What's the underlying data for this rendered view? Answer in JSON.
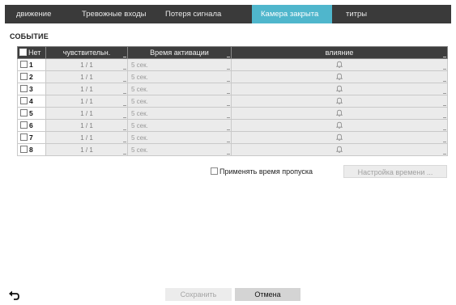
{
  "tabs": [
    {
      "label": "движение",
      "active": false
    },
    {
      "label": "Тревожные входы",
      "active": false
    },
    {
      "label": "Потеря сигнала",
      "active": false
    },
    {
      "label": "Камера закрыта",
      "active": true
    },
    {
      "label": "титры",
      "active": false
    }
  ],
  "section_title": "СОБЫТИЕ",
  "table": {
    "columns": {
      "none": "Нет",
      "sensitivity": "чувствительн.",
      "activation_time": "Время активации",
      "influence": "влияние"
    },
    "rows": [
      {
        "num": "1",
        "sensitivity": "1 / 1",
        "activation": "5 сек.",
        "influence_icon": "bell-icon"
      },
      {
        "num": "2",
        "sensitivity": "1 / 1",
        "activation": "5 сек.",
        "influence_icon": "bell-icon"
      },
      {
        "num": "3",
        "sensitivity": "1 / 1",
        "activation": "5 сек.",
        "influence_icon": "bell-icon"
      },
      {
        "num": "4",
        "sensitivity": "1 / 1",
        "activation": "5 сек.",
        "influence_icon": "bell-icon"
      },
      {
        "num": "5",
        "sensitivity": "1 / 1",
        "activation": "5 сек.",
        "influence_icon": "bell-icon"
      },
      {
        "num": "6",
        "sensitivity": "1 / 1",
        "activation": "5 сек.",
        "influence_icon": "bell-icon"
      },
      {
        "num": "7",
        "sensitivity": "1 / 1",
        "activation": "5 сек.",
        "influence_icon": "bell-icon"
      },
      {
        "num": "8",
        "sensitivity": "1 / 1",
        "activation": "5 сек.",
        "influence_icon": "bell-icon"
      }
    ]
  },
  "skip_time_label": "Применять время пропуска",
  "time_settings_label": "Настройка времени ...",
  "save_label": "Сохранить",
  "cancel_label": "Отмена",
  "back_icon": "back-arrow-icon",
  "colors": {
    "tabbar": "#3a3a3a",
    "active_tab": "#4fb6cc",
    "header": "#3d3d3d"
  }
}
